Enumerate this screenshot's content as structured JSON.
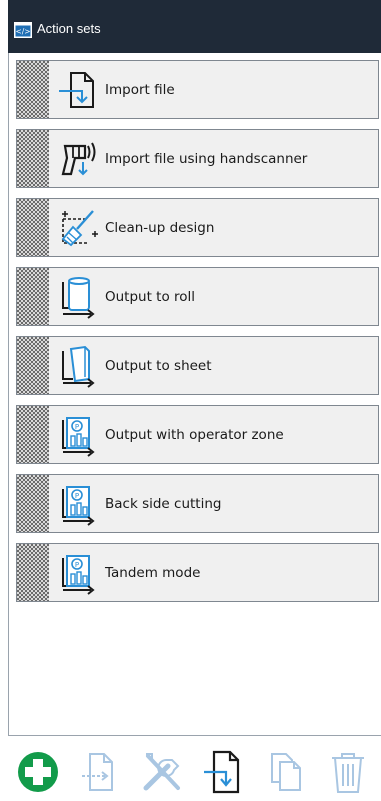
{
  "header": {
    "title": "Action sets",
    "icon": "code-icon"
  },
  "items": [
    {
      "label": "Import file",
      "icon": "import-file-icon"
    },
    {
      "label": "Import file using handscanner",
      "icon": "handscanner-icon"
    },
    {
      "label": "Clean-up design",
      "icon": "cleanup-broom-icon"
    },
    {
      "label": "Output to roll",
      "icon": "roll-output-icon"
    },
    {
      "label": "Output to sheet",
      "icon": "sheet-output-icon"
    },
    {
      "label": "Output with operator zone",
      "icon": "operator-zone-icon"
    },
    {
      "label": "Back side cutting",
      "icon": "operator-zone-icon"
    },
    {
      "label": "Tandem mode",
      "icon": "operator-zone-icon"
    }
  ],
  "toolbar": {
    "buttons": [
      "add-icon",
      "copy-icon",
      "edit-tools-icon",
      "import-icon",
      "duplicate-icon",
      "delete-icon"
    ]
  },
  "colors": {
    "header_bg": "#1f2a38",
    "accent_blue": "#2a8fd6",
    "add_green": "#129b4a"
  }
}
